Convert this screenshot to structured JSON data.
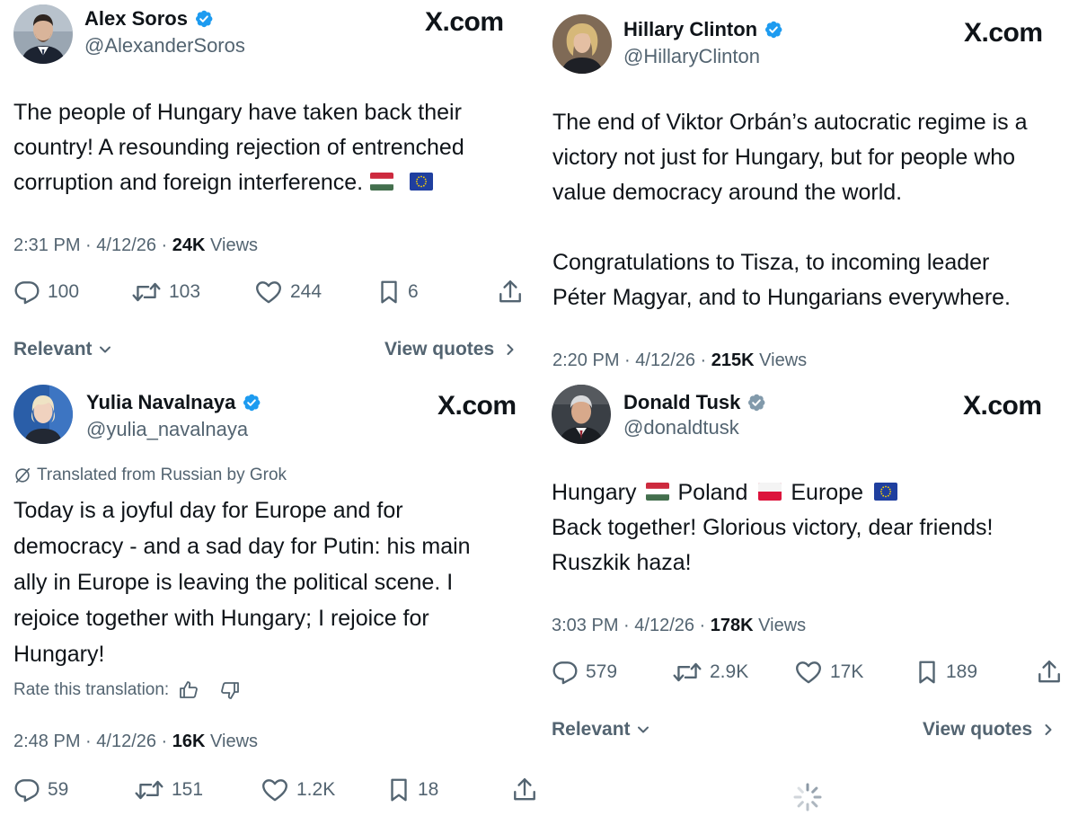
{
  "brand_label": "X.com",
  "colors": {
    "verified_blue": "#1d9bf0",
    "verified_gray": "#829aab",
    "muted": "#536471",
    "text": "#0f1419"
  },
  "tweets": [
    {
      "author": "Alex Soros",
      "handle": "@AlexanderSoros",
      "verified": "blue",
      "lines": [
        "The people of Hungary have taken back their",
        "country! A resounding rejection of entrenched",
        "corruption and foreign interference."
      ],
      "flags": [
        "hungary-flag",
        "eu-flag"
      ],
      "time": "2:31 PM",
      "date": "4/12/26",
      "views_count": "24K",
      "views_label": "Views",
      "replies": "100",
      "reposts": "103",
      "likes": "244",
      "bookmarks": "6",
      "relevant_label": "Relevant",
      "view_quotes_label": "View quotes"
    },
    {
      "author": "Hillary Clinton",
      "handle": "@HillaryClinton",
      "verified": "blue",
      "lines": [
        "The end of Viktor Orbán’s autocratic regime is a",
        "victory not just for Hungary, but for people who",
        "value democracy around the world.",
        "",
        "Congratulations to Tisza, to incoming leader",
        "Péter Magyar, and to Hungarians everywhere."
      ],
      "time": "2:20 PM",
      "date": "4/12/26",
      "views_count": "215K",
      "views_label": "Views"
    },
    {
      "author": "Yulia Navalnaya",
      "handle": "@yulia_navalnaya",
      "verified": "blue",
      "translated_label": "Translated from Russian by Grok",
      "lines": [
        "Today is a joyful day for Europe and for",
        "democracy - and a sad day for Putin: his main",
        "ally in Europe is leaving the political scene. I",
        "rejoice together with Hungary; I rejoice for",
        "Hungary!"
      ],
      "rate_label": "Rate this translation:",
      "time": "2:48 PM",
      "date": "4/12/26",
      "views_count": "16K",
      "views_label": "Views",
      "replies": "59",
      "reposts": "151",
      "likes": "1.2K",
      "bookmarks": "18"
    },
    {
      "author": "Donald Tusk",
      "handle": "@donaldtusk",
      "verified": "gray",
      "line1_parts": [
        "Hungary",
        "Poland",
        "Europe"
      ],
      "line1_flags": [
        "hungary-flag",
        "poland-flag",
        "eu-flag"
      ],
      "lines": [
        "Back together!  Glorious victory, dear friends!",
        "Ruszkik haza!"
      ],
      "time": "3:03 PM",
      "date": "4/12/26",
      "views_count": "178K",
      "views_label": "Views",
      "replies": "579",
      "reposts": "2.9K",
      "likes": "17K",
      "bookmarks": "189",
      "relevant_label": "Relevant",
      "view_quotes_label": "View quotes"
    }
  ]
}
